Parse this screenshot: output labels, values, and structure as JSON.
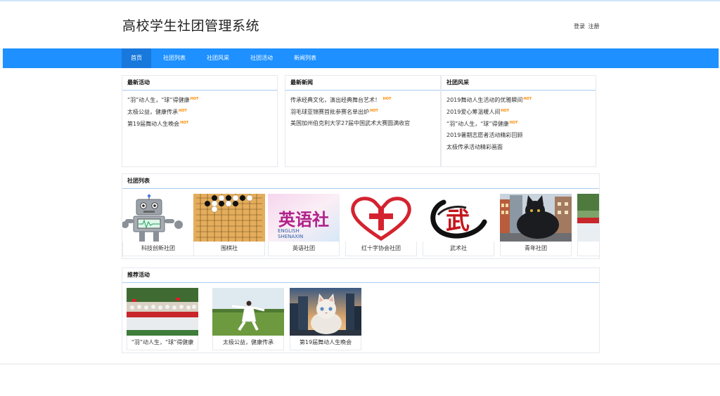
{
  "site": {
    "title": "高校学生社团管理系统",
    "login": "登录",
    "register": "注册"
  },
  "nav": [
    {
      "label": "首页",
      "active": true
    },
    {
      "label": "社团列表"
    },
    {
      "label": "社团风采"
    },
    {
      "label": "社团活动"
    },
    {
      "label": "新闻列表"
    }
  ],
  "hot_tag": "HOT",
  "latest_activities": {
    "title": "最新活动",
    "items": [
      {
        "text": "“羽”动人生，“球”得健康",
        "hot": true
      },
      {
        "text": "太极公益，健康传承",
        "hot": true
      },
      {
        "text": "第19届舞动人生晚会",
        "hot": true
      }
    ]
  },
  "latest_news": {
    "title": "最新新闻",
    "items": [
      {
        "text": "传承经典文化，演出经典舞台艺术！",
        "hot": true
      },
      {
        "text": "羽毛球亚锦赛首批参赛名单出炉",
        "hot": true
      },
      {
        "text": "美国加州伯克利大学27届中国武术大赛圆满收官",
        "hot": false
      }
    ]
  },
  "club_style": {
    "title": "社团风采",
    "items": [
      {
        "text": "2019舞动人生活动的优雅瞬间",
        "hot": true
      },
      {
        "text": "2019爱心筹温暖人间",
        "hot": true
      },
      {
        "text": "“羽”动人生，“球”得健康",
        "hot": true
      },
      {
        "text": "2019暑期志愿者活动精彩回顾",
        "hot": false
      },
      {
        "text": "太极传承活动精彩画面",
        "hot": false
      }
    ]
  },
  "club_list": {
    "title": "社团列表",
    "clubs": [
      {
        "name": "科技创新社团",
        "image": "robot-image"
      },
      {
        "name": "围棋社",
        "image": "go-board-image"
      },
      {
        "name": "英语社团",
        "image": "english-club-image",
        "image_text_main": "英语社",
        "image_text_line1": "ENGLISH",
        "image_text_line2": "SHENAXIN"
      },
      {
        "name": "红十字协会社团",
        "image": "red-cross-heart-image"
      },
      {
        "name": "武术社",
        "image": "martial-arts-calligraphy-image",
        "image_text": "武"
      },
      {
        "name": "青年社团",
        "image": "black-cat-city-image"
      },
      {
        "name": "",
        "image": "group-photo-image"
      }
    ]
  },
  "recommended": {
    "title": "推荐活动",
    "items": [
      {
        "name": "“羽”动人生，“球”得健康",
        "image": "group-photo-image"
      },
      {
        "name": "太极公益，健康传承",
        "image": "tai-chi-image"
      },
      {
        "name": "第19届舞动人生晚会",
        "image": "white-cat-city-image"
      }
    ]
  }
}
